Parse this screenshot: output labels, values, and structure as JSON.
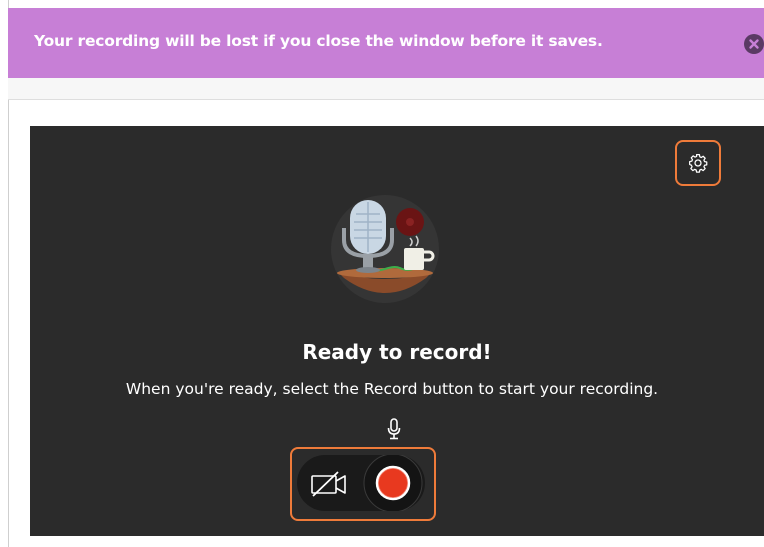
{
  "banner": {
    "message": "Your recording will be lost if you close the window before it saves.",
    "close_icon": "close-circle-icon",
    "color": "#c77fd6"
  },
  "recorder": {
    "background": "#2b2b2b",
    "accent": "#ef7b3a",
    "settings_icon": "gear-icon",
    "illustration_icon": "podcast-microphone-illustration",
    "heading": "Ready to record!",
    "instructions": "When you're ready, select the Record button to start your recording.",
    "mic_icon": "microphone-icon",
    "camera_icon": "camera-off-icon",
    "record_icon": "record-icon",
    "record_color": "#e8391f"
  }
}
